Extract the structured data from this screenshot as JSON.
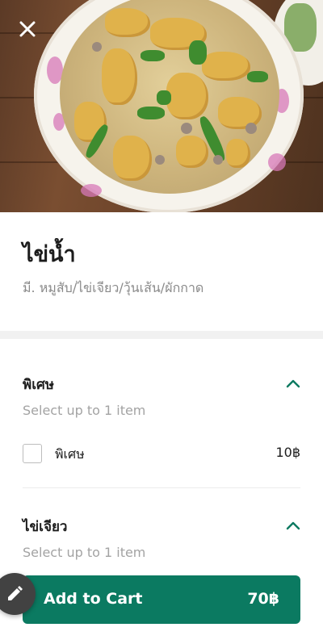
{
  "dish": {
    "name": "ไข่น้ำ",
    "description": "มี. หมูสับ/ไข่เจียว/วุ้นเส้น/ผักกาด"
  },
  "groups": [
    {
      "title": "พิเศษ",
      "hint": "Select up to 1 item",
      "options": [
        {
          "label": "พิเศษ",
          "price": "10฿",
          "checked": false
        }
      ]
    },
    {
      "title": "ไข่เจียว",
      "hint": "Select up to 1 item"
    }
  ],
  "cart": {
    "label": "Add to Cart",
    "price": "70฿"
  },
  "colors": {
    "accent": "#0b7a61",
    "chevron": "#0b7a61",
    "fab": "#424242"
  },
  "icons": {
    "close": "close-icon",
    "chevron": "chevron-up-icon",
    "edit": "pencil-icon"
  }
}
